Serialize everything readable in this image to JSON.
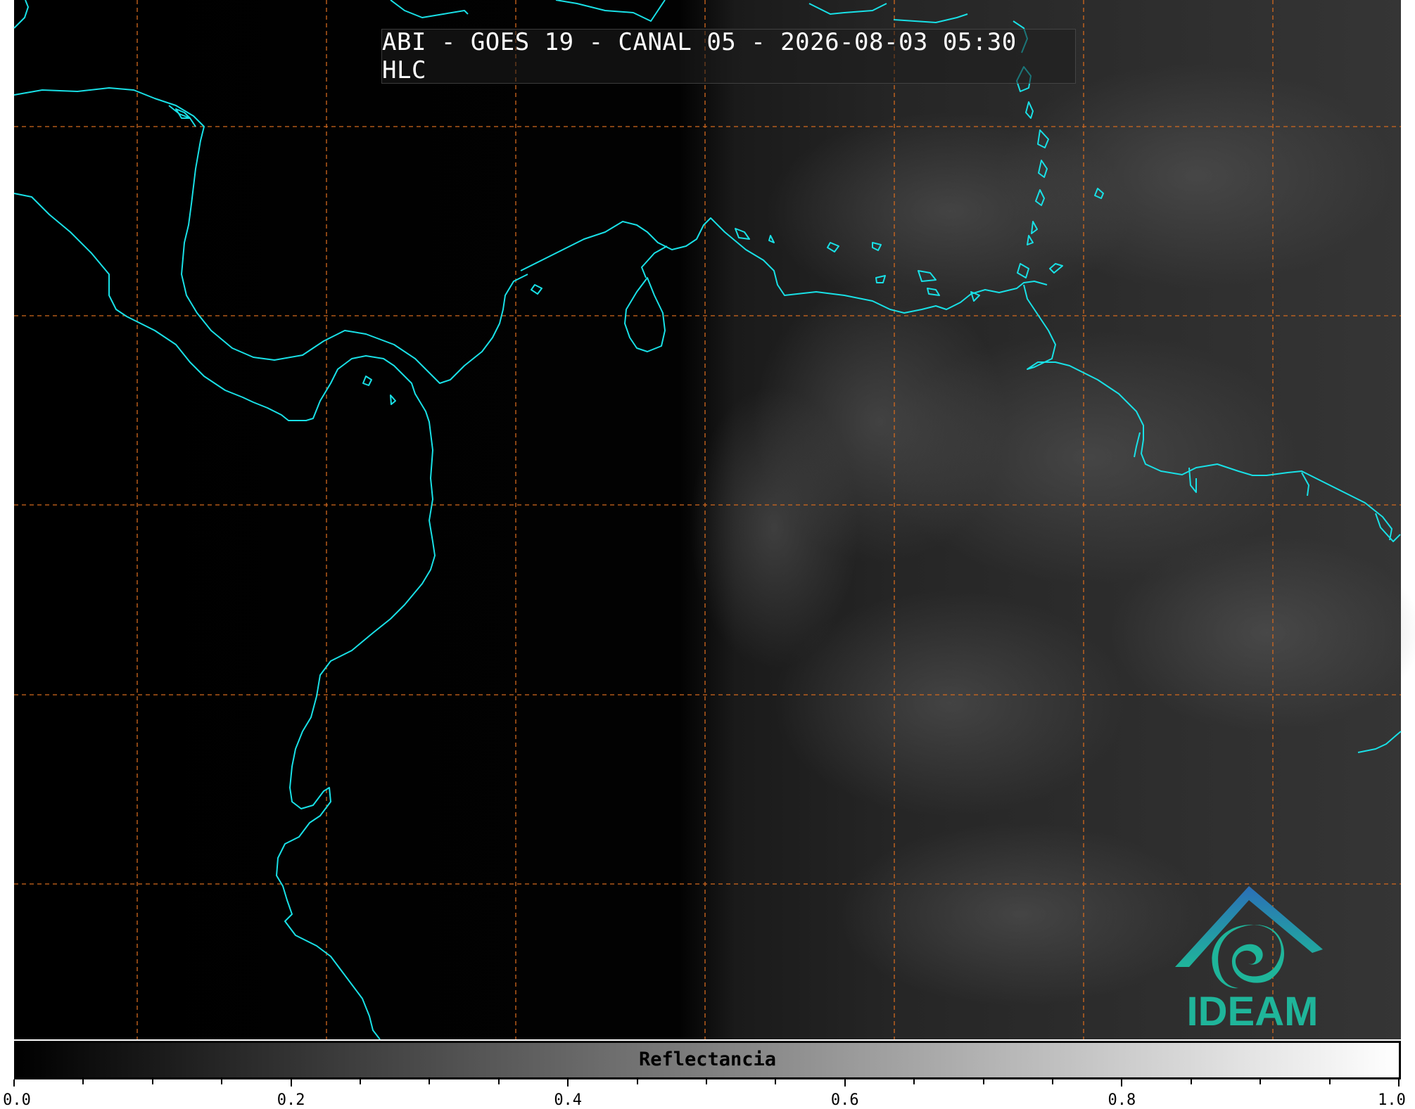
{
  "title": "ABI - GOES 19 - CANAL 05 - 2026-08-03 05:30 HLC",
  "colorbar": {
    "label": "Reflectancia",
    "range": [
      0.0,
      1.0
    ],
    "ticks": [
      "0.0",
      "0.2",
      "0.4",
      "0.6",
      "0.8",
      "1.0"
    ]
  },
  "logo": {
    "text": "IDEAM"
  },
  "colors": {
    "coastline": "#19e0e6",
    "graticule": "#d2691e",
    "logo_teal": "#1fb59a",
    "logo_blue": "#2b6fb8"
  }
}
